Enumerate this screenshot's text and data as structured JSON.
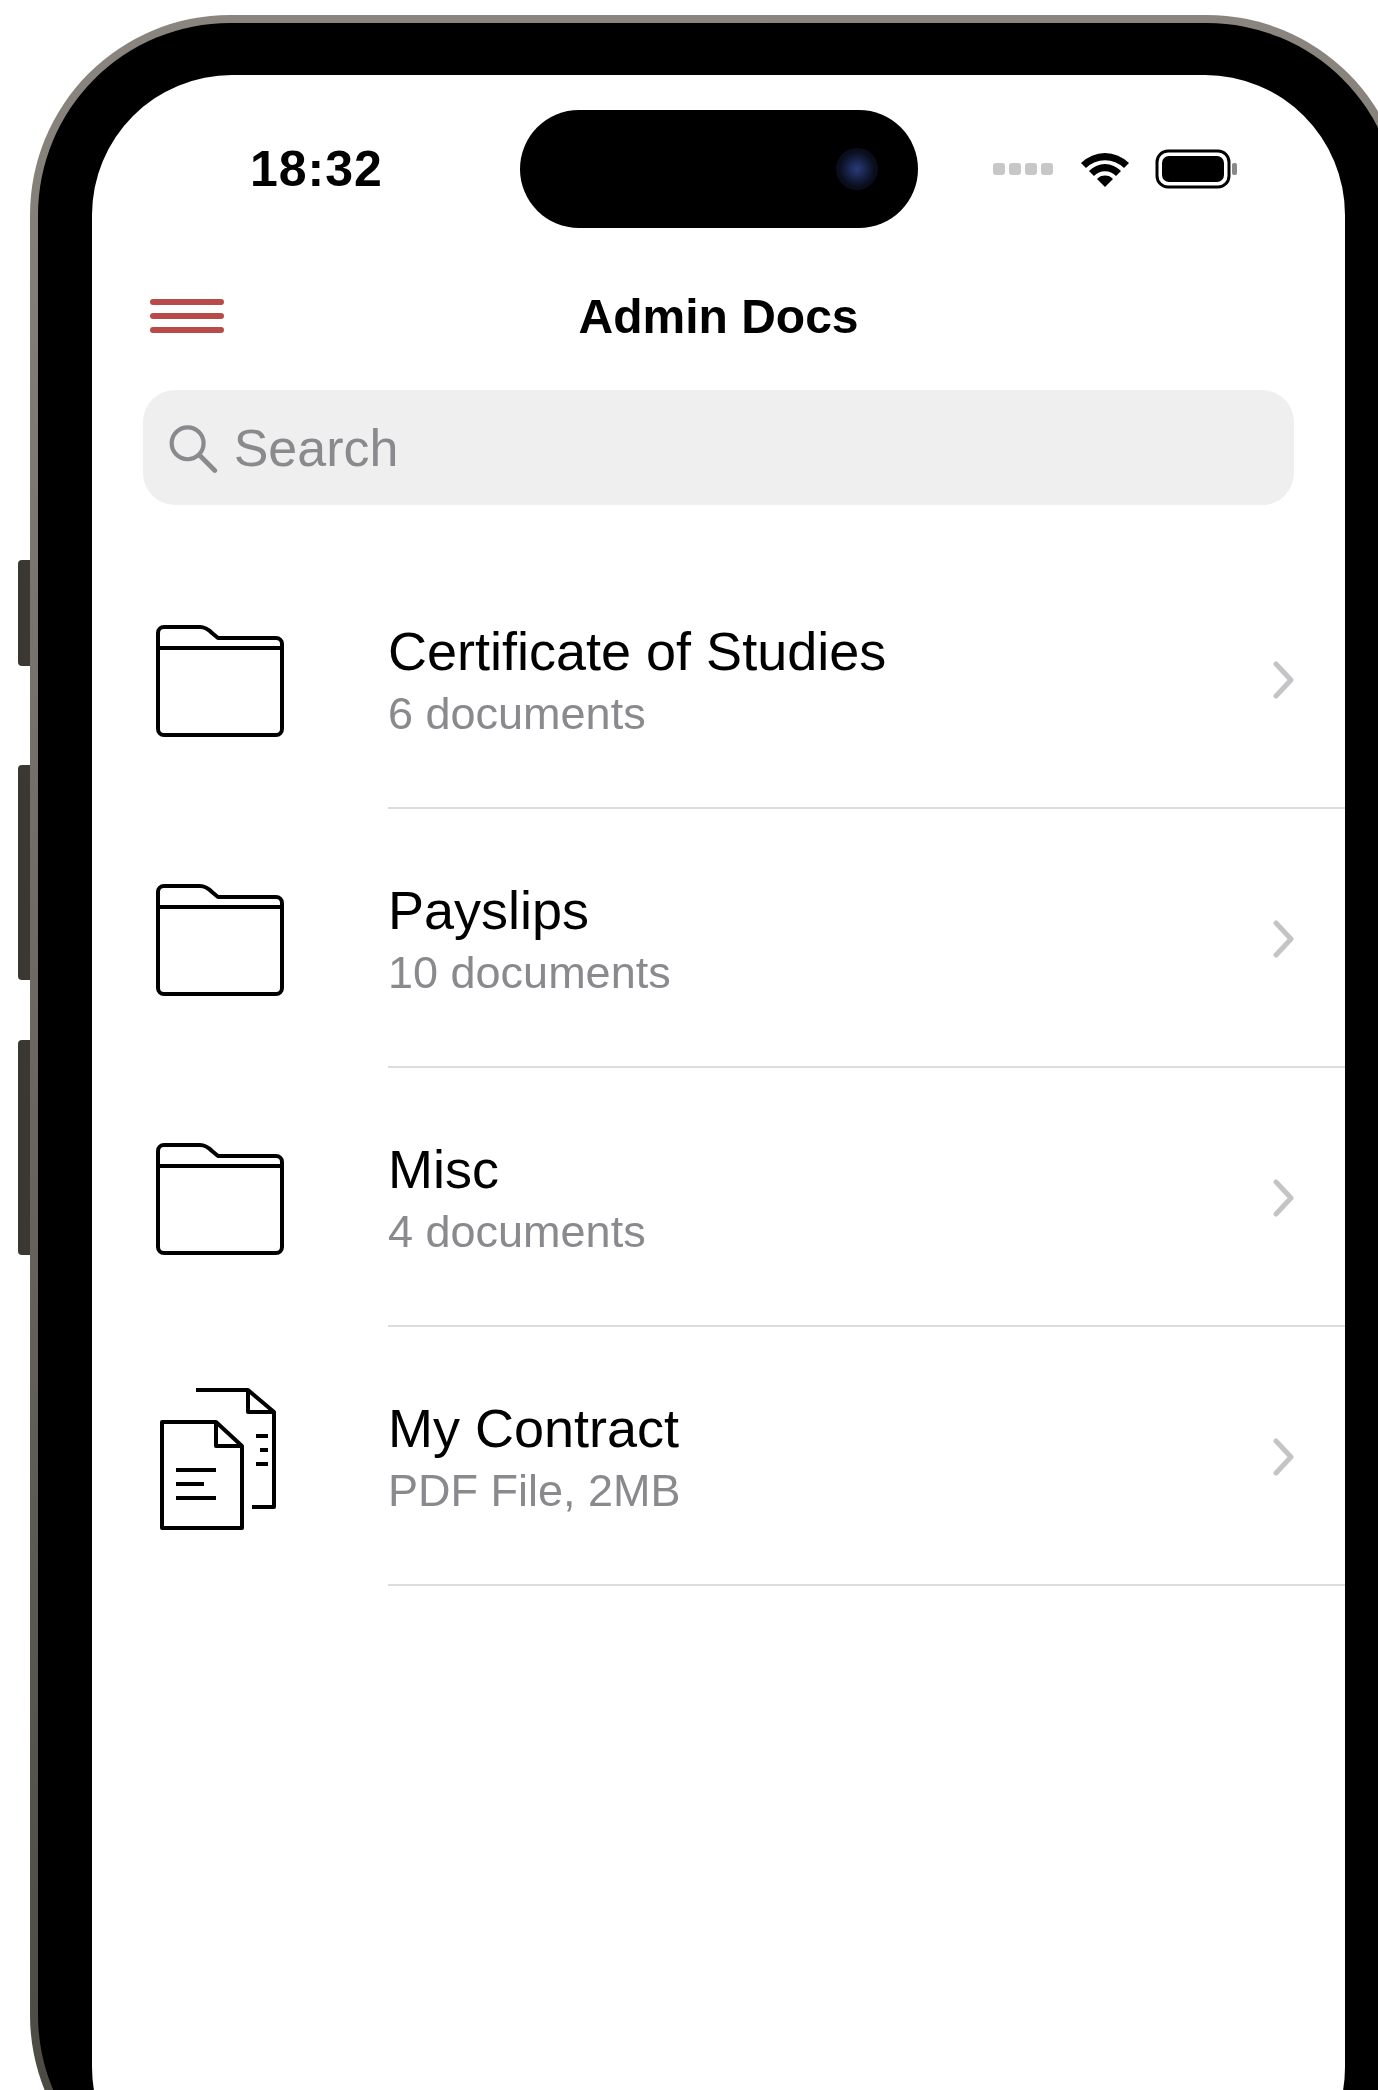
{
  "status_bar": {
    "time": "18:32"
  },
  "nav": {
    "title": "Admin Docs"
  },
  "search": {
    "placeholder": "Search"
  },
  "items": [
    {
      "kind": "folder",
      "title": "Certificate of Studies",
      "subtitle": "6 documents"
    },
    {
      "kind": "folder",
      "title": "Payslips",
      "subtitle": "10 documents"
    },
    {
      "kind": "folder",
      "title": "Misc",
      "subtitle": "4 documents"
    },
    {
      "kind": "document",
      "title": "My Contract",
      "subtitle": "PDF File, 2MB"
    }
  ]
}
